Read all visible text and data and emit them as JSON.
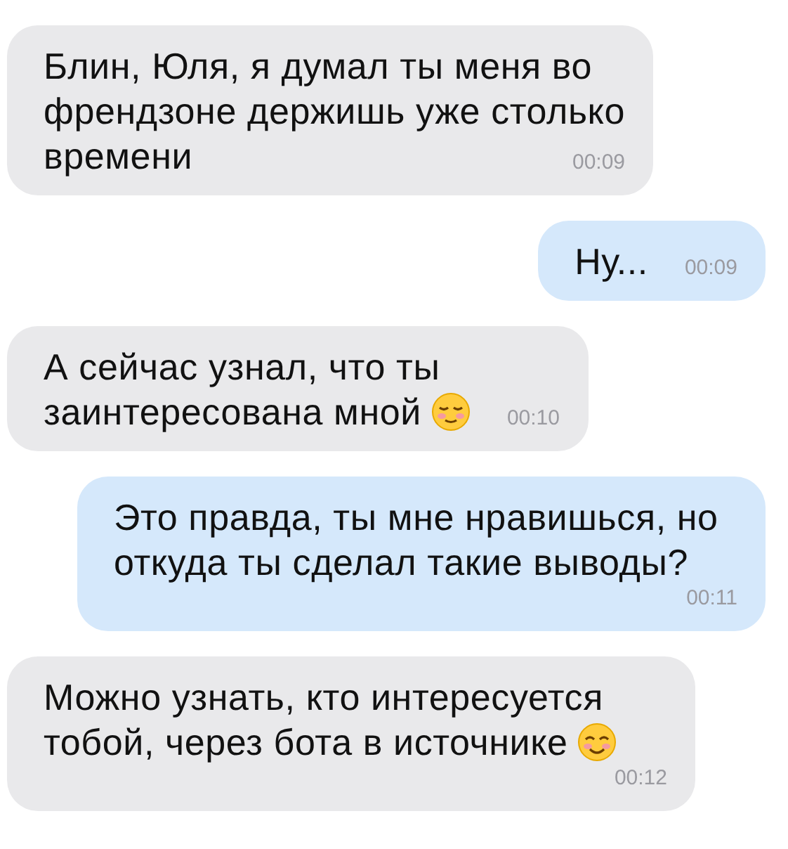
{
  "messages": [
    {
      "kind": "incoming",
      "lines": [
        "Блин, Юля, я думал ты меня во",
        "френдзоне держишь уже столько",
        "времени"
      ],
      "time": "00:09"
    },
    {
      "kind": "outgoing",
      "lines": [
        "Ну..."
      ],
      "time": "00:09"
    },
    {
      "kind": "incoming",
      "lines": [
        "А сейчас узнал, что ты",
        "заинтересована мной"
      ],
      "emoji": {
        "kind": "relieved"
      },
      "time": "00:10"
    },
    {
      "kind": "outgoing",
      "lines": [
        "Это правда, ты мне нравишься, но",
        "откуда ты сделал такие выводы?"
      ],
      "time": "00:11"
    },
    {
      "kind": "incoming",
      "lines": [
        "Можно узнать, кто интересуется",
        "тобой, через бота в источнике"
      ],
      "emoji": {
        "kind": "smiling"
      },
      "time": "00:12"
    }
  ]
}
